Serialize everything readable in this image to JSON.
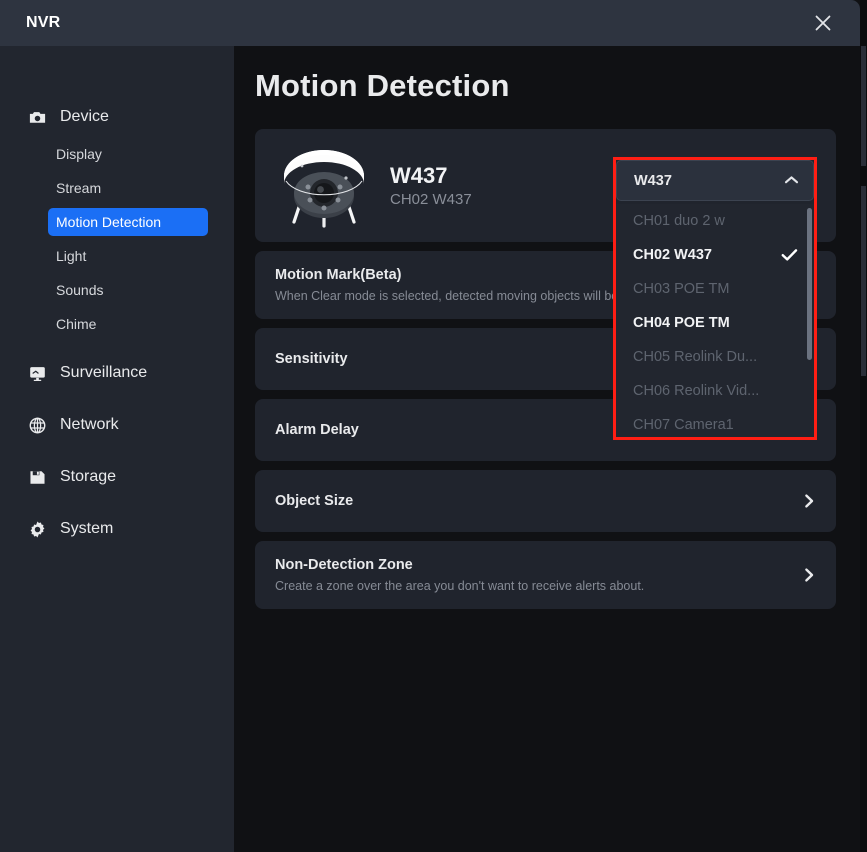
{
  "window": {
    "title": "NVR",
    "close_icon": "close-icon"
  },
  "sidebar": {
    "groups": [
      {
        "icon": "camera-icon",
        "label": "Device",
        "items": [
          {
            "label": "Display",
            "active": false
          },
          {
            "label": "Stream",
            "active": false
          },
          {
            "label": "Motion Detection",
            "active": true
          },
          {
            "label": "Light",
            "active": false
          },
          {
            "label": "Sounds",
            "active": false
          },
          {
            "label": "Chime",
            "active": false
          }
        ]
      },
      {
        "icon": "monitor-icon",
        "label": "Surveillance",
        "items": []
      },
      {
        "icon": "globe-icon",
        "label": "Network",
        "items": []
      },
      {
        "icon": "storage-icon",
        "label": "Storage",
        "items": []
      },
      {
        "icon": "gear-icon",
        "label": "System",
        "items": []
      }
    ],
    "active_color": "#1B6FF5"
  },
  "main": {
    "page_title": "Motion Detection",
    "device": {
      "name": "W437",
      "channel": "CH02 W437",
      "thumbnail_icon": "dome-camera-image"
    },
    "rows": [
      {
        "title": "Motion Mark(Beta)",
        "desc": "When Clear mode is selected, detected moving objects will be m",
        "chevron": false
      },
      {
        "title": "Sensitivity",
        "desc": "",
        "chevron": false
      },
      {
        "title": "Alarm Delay",
        "desc": "",
        "chevron": false
      },
      {
        "title": "Object Size",
        "desc": "",
        "chevron": true
      },
      {
        "title": "Non-Detection Zone",
        "desc": "Create a zone over the area you don't want to receive alerts about.",
        "chevron": true
      }
    ]
  },
  "channel_dropdown": {
    "selected_label": "W437",
    "expanded": true,
    "chevron_icon": "chevron-up-icon",
    "highlight_color": "#FF1E14",
    "options": [
      {
        "label": "CH01 duo 2 w",
        "enabled": false,
        "checked": false
      },
      {
        "label": "CH02 W437",
        "enabled": true,
        "checked": true
      },
      {
        "label": "CH03 POE TM",
        "enabled": false,
        "checked": false
      },
      {
        "label": "CH04 POE TM",
        "enabled": true,
        "checked": false
      },
      {
        "label": "CH05 Reolink Du...",
        "enabled": false,
        "checked": false
      },
      {
        "label": "CH06 Reolink Vid...",
        "enabled": false,
        "checked": false
      },
      {
        "label": "CH07 Camera1",
        "enabled": false,
        "checked": false
      }
    ]
  }
}
